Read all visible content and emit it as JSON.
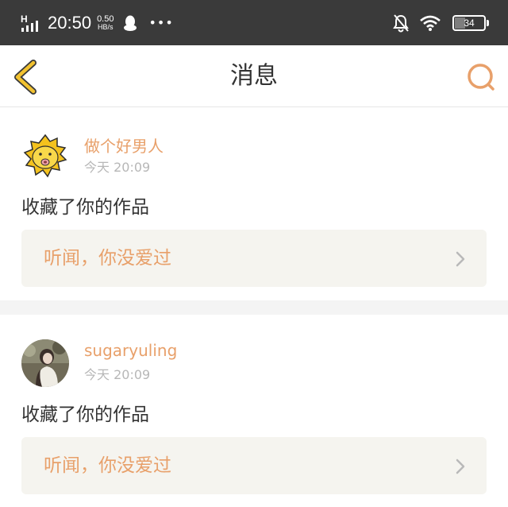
{
  "status_bar": {
    "signal_label": "H",
    "time": "20:50",
    "speed_value": "0.50",
    "speed_unit": "HB/s",
    "more": "•••",
    "battery_percent": "34",
    "battery_level": 0.34
  },
  "nav": {
    "title": "消息",
    "back_icon": "chevron-left-icon",
    "search_icon": "search-icon",
    "accent": "#e8a06a",
    "back_color": "#f2c230"
  },
  "messages": [
    {
      "username": "做个好男人",
      "time": "今天 20:09",
      "action": "收藏了你的作品",
      "work_title": "听闻，你没爱过"
    },
    {
      "username": "sugaryuling",
      "time": "今天 20:09",
      "action": "收藏了你的作品",
      "work_title": "听闻，你没爱过"
    }
  ]
}
